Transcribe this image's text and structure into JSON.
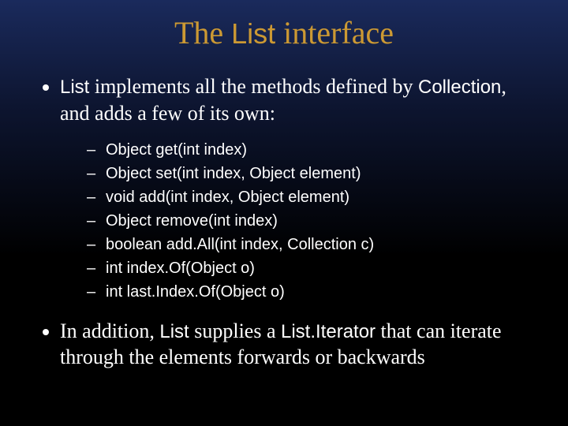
{
  "title": {
    "prefix": "The ",
    "keyword": "List",
    "suffix": " interface"
  },
  "bullet1": {
    "p1_sans": "List",
    "p2": " implements all the methods defined by ",
    "p3_sans": "Collection",
    "p4": ", and adds a few of its own:"
  },
  "methods": [
    "Object get(int index)",
    "Object set(int index, Object element)",
    "void add(int index, Object element)",
    "Object remove(int index)",
    "boolean add.All(int index, Collection c)",
    "int index.Of(Object o)",
    "int last.Index.Of(Object o)"
  ],
  "bullet2": {
    "p1": "In addition, ",
    "p2_sans": "List",
    "p3": " supplies a ",
    "p4_sans": "List.Iterator",
    "p5": " that can iterate through the elements forwards or backwards"
  }
}
